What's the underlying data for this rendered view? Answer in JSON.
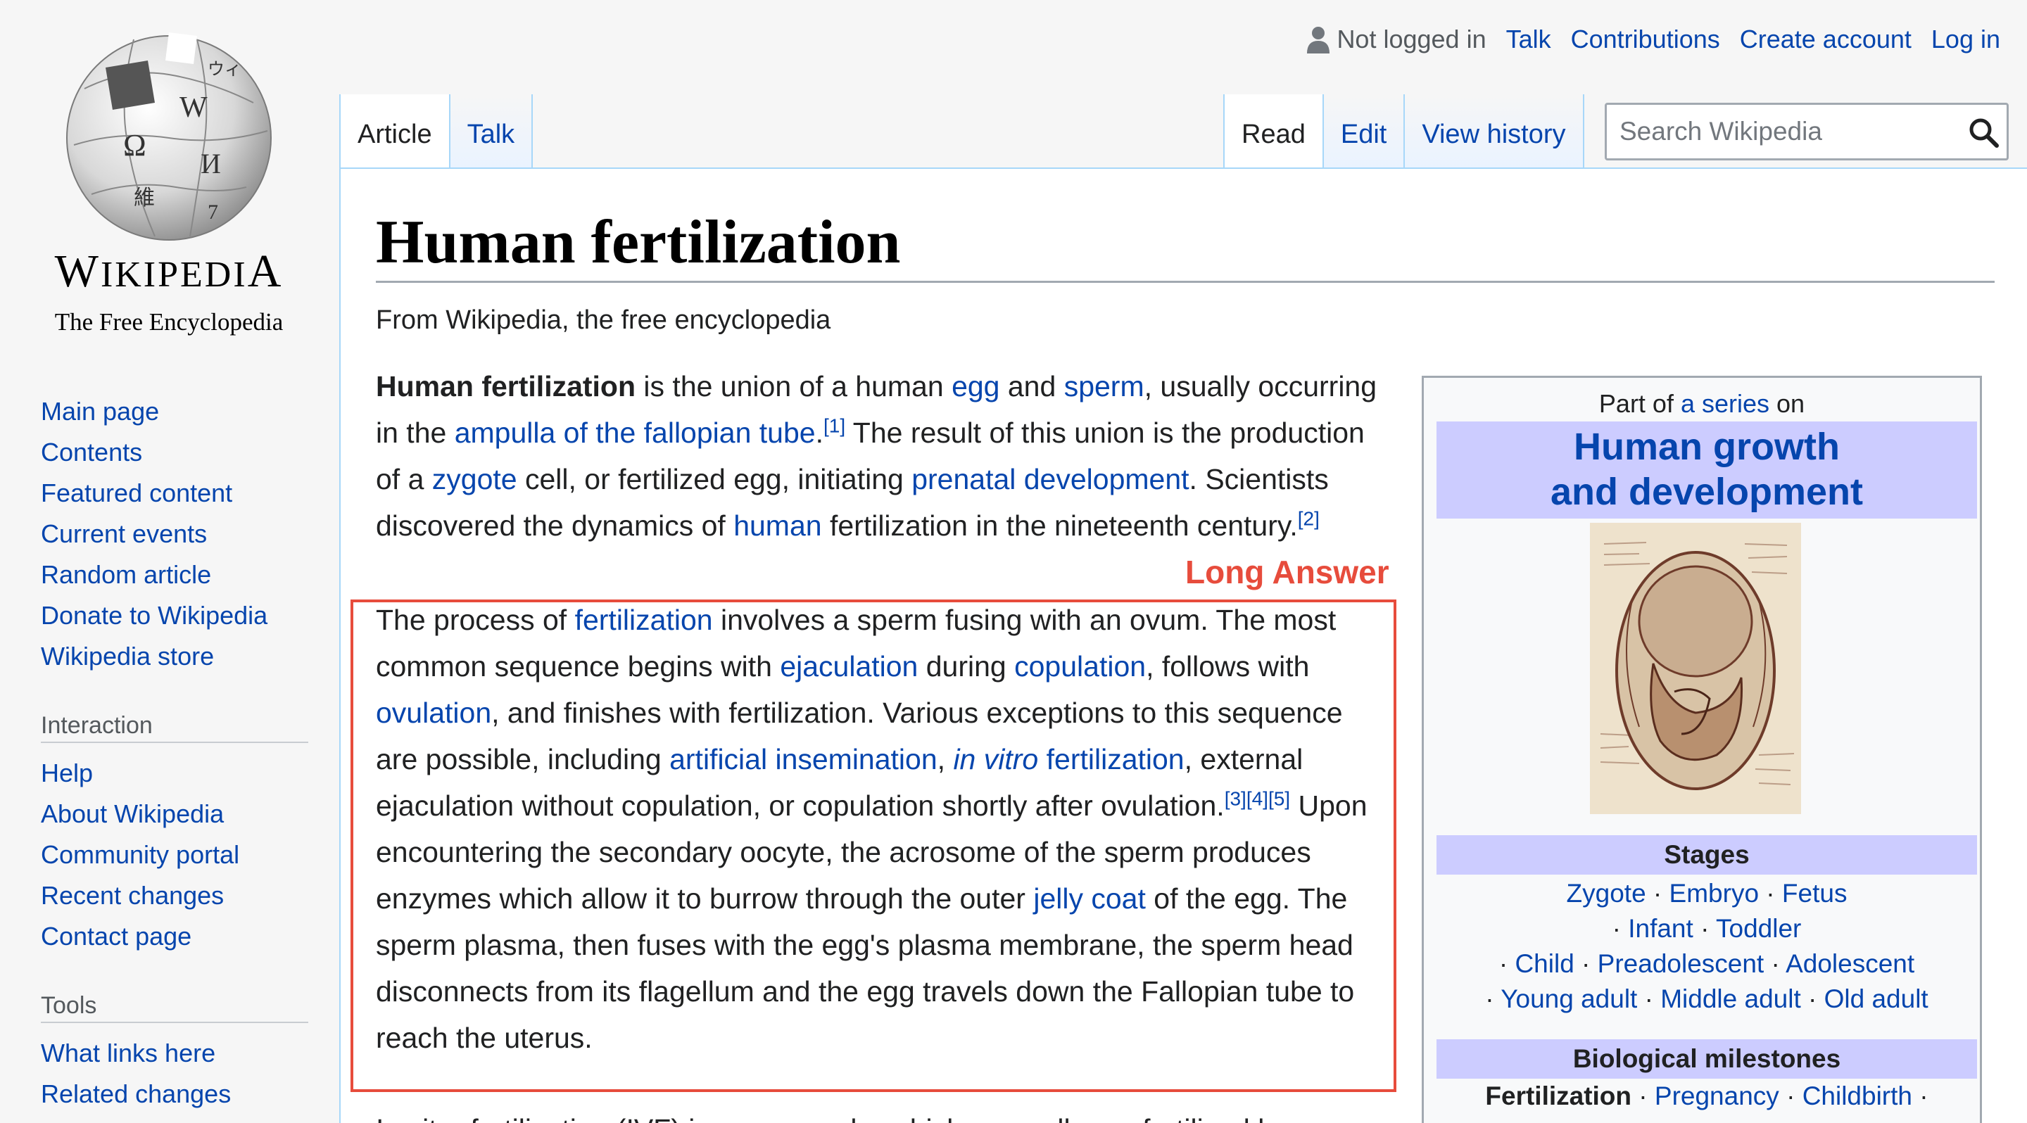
{
  "logo": {
    "wordmark_big": "W",
    "wordmark_rest": "IKIPEDI",
    "wordmark_end": "A",
    "tagline": "The Free Encyclopedia"
  },
  "nav": {
    "items": [
      "Main page",
      "Contents",
      "Featured content",
      "Current events",
      "Random article",
      "Donate to Wikipedia",
      "Wikipedia store"
    ],
    "interaction_heading": "Interaction",
    "interaction_items": [
      "Help",
      "About Wikipedia",
      "Community portal",
      "Recent changes",
      "Contact page"
    ],
    "tools_heading": "Tools",
    "tools_items": [
      "What links here",
      "Related changes"
    ]
  },
  "personal": {
    "status": "Not logged in",
    "talk": "Talk",
    "contributions": "Contributions",
    "create_account": "Create account",
    "login": "Log in"
  },
  "tabs": {
    "article": "Article",
    "talk": "Talk",
    "read": "Read",
    "edit": "Edit",
    "history": "View history"
  },
  "search": {
    "placeholder": "Search Wikipedia"
  },
  "article": {
    "title": "Human fertilization",
    "tagline": "From Wikipedia, the free encyclopedia",
    "p1": {
      "bold": "Human fertilization",
      "t1": " is the union of a human ",
      "l_egg": "egg",
      "t2": " and ",
      "l_sperm": "sperm",
      "t3": ", usually occurring in the ",
      "l_ampulla": "ampulla of the fallopian tube",
      "t4": ".",
      "ref1": "[1]",
      "t5": " The result of this union is the production of a ",
      "l_zygote": "zygote",
      "t6": " cell, or fertilized egg, initiating ",
      "l_prenatal": "prenatal development",
      "t7": ". Scientists discovered the dynamics of ",
      "l_human": "human",
      "t8": " fertilization in the nineteenth century.",
      "ref2": "[2]"
    },
    "long_answer_label": "Long Answer",
    "p2": {
      "t1": "The process of ",
      "l_fert": "fertilization",
      "t2": " involves a sperm fusing with an ovum. The most common sequence begins with ",
      "l_ejac": "ejaculation",
      "t3": " during ",
      "l_copu": "copulation",
      "t4": ", follows with ",
      "l_ovul": "ovulation",
      "t5": ", and finishes with fertilization. Various exceptions to this sequence are possible, including ",
      "l_ai": "artificial insemination",
      "t6": ", ",
      "l_invitro": "in vitro",
      "t7": " ",
      "l_fert2": "fertilization",
      "t8": ", external ejaculation without copulation, or copulation shortly after ovulation.",
      "refs": "[3][4][5]",
      "t9": " Upon encountering the secondary oocyte, the acrosome of the sperm produces enzymes which allow it to burrow through the outer ",
      "l_jelly": "jelly coat",
      "t10": " of the egg. The sperm plasma, then fuses with the egg's plasma membrane, the sperm head disconnects from its flagellum and the egg travels down the Fallopian tube to reach the uterus."
    },
    "p3": "In vitro fertilization (IVF) is a process by which egg cells are fertilized by"
  },
  "infobox": {
    "part_of": "Part of ",
    "series": "a series",
    "on": " on",
    "title_line1": "Human growth",
    "title_line2": "and development",
    "stages_heading": "Stages",
    "stages": [
      "Zygote",
      "Embryo",
      "Fetus",
      "Infant",
      "Toddler",
      "Child",
      "Preadolescent",
      "Adolescent",
      "Young adult",
      "Middle adult",
      "Old adult"
    ],
    "milestones_heading": "Biological milestones",
    "milestones_bold": "Fertilization",
    "milestones": [
      "Pregnancy",
      "Childbirth"
    ]
  },
  "colors": {
    "link": "#0645ad",
    "highlight": "#e74c3c",
    "infobox_header": "#ccccff"
  }
}
